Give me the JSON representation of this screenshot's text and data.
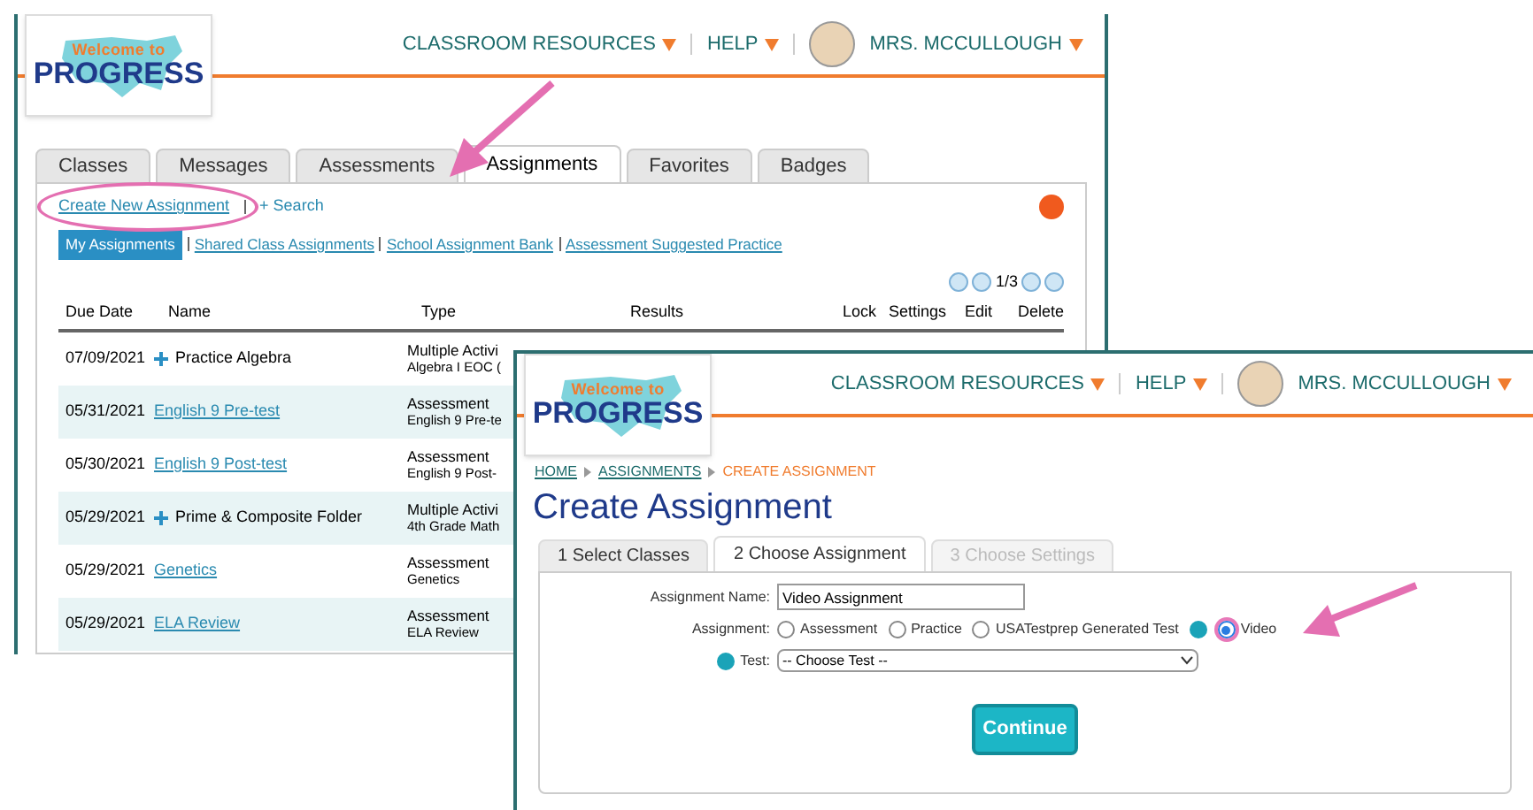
{
  "back_window": {
    "logo": {
      "line1": "Welcome to",
      "line2": "PROGRESS"
    },
    "nav": [
      {
        "label": "CLASSROOM RESOURCES"
      },
      {
        "label": "HELP"
      }
    ],
    "user": "MRS. MCCULLOUGH",
    "tabs": [
      {
        "label": "Classes",
        "selected": false
      },
      {
        "label": "Messages",
        "selected": false
      },
      {
        "label": "Assessments",
        "selected": false
      },
      {
        "label": "Assignments",
        "selected": true
      },
      {
        "label": "Favorites",
        "selected": false
      },
      {
        "label": "Badges",
        "selected": false
      }
    ],
    "actions": [
      {
        "label": "Create New Assignment"
      },
      {
        "label": "+ Search"
      }
    ],
    "subtabs": [
      {
        "label": "My Assignments",
        "selected": true
      },
      {
        "label": "Shared Class Assignments",
        "selected": false
      },
      {
        "label": "School Assignment Bank",
        "selected": false
      },
      {
        "label": "Assessment Suggested Practice",
        "selected": false
      }
    ],
    "pager": "1/3",
    "table": {
      "columns": [
        "Due Date",
        "Name",
        "Type",
        "Results",
        "Lock",
        "Settings",
        "Edit",
        "Delete"
      ],
      "rows": [
        {
          "due": "07/09/2021",
          "name": "Practice Algebra",
          "kind": "folder",
          "type": "Multiple Activi",
          "subtype": "Algebra I EOC ("
        },
        {
          "due": "05/31/2021",
          "name": "English 9 Pre-test",
          "kind": "link",
          "type": "Assessment",
          "subtype": "English 9 Pre-te"
        },
        {
          "due": "05/30/2021",
          "name": "English 9 Post-test",
          "kind": "link",
          "type": "Assessment",
          "subtype": "English 9 Post-"
        },
        {
          "due": "05/29/2021",
          "name": "Prime & Composite Folder",
          "kind": "folder",
          "type": "Multiple Activi",
          "subtype": "4th Grade Math"
        },
        {
          "due": "05/29/2021",
          "name": "Genetics",
          "kind": "link",
          "type": "Assessment",
          "subtype": "Genetics"
        },
        {
          "due": "05/29/2021",
          "name": "ELA Review",
          "kind": "link",
          "type": "Assessment",
          "subtype": "ELA Review"
        }
      ]
    }
  },
  "front_window": {
    "logo": {
      "line1": "Welcome to",
      "line2": "PROGRESS"
    },
    "nav": [
      {
        "label": "CLASSROOM RESOURCES"
      },
      {
        "label": "HELP"
      }
    ],
    "user": "MRS. MCCULLOUGH",
    "breadcrumb": [
      {
        "label": "HOME",
        "kind": "link"
      },
      {
        "label": "ASSIGNMENTS",
        "kind": "link"
      },
      {
        "label": "CREATE ASSIGNMENT",
        "kind": "current"
      }
    ],
    "title": "Create Assignment",
    "steps": [
      {
        "label": "1 Select Classes",
        "selected": false,
        "disabled": false
      },
      {
        "label": "2 Choose Assignment",
        "selected": true,
        "disabled": false
      },
      {
        "label": "3 Choose Settings",
        "selected": false,
        "disabled": true
      }
    ],
    "form": {
      "name_label": "Assignment Name:",
      "name_value": "Video Assignment",
      "assignment_label": "Assignment:",
      "options": [
        {
          "label": "Assessment",
          "selected": false,
          "info": false
        },
        {
          "label": "Practice",
          "selected": false,
          "info": false
        },
        {
          "label": "USATestprep Generated Test",
          "selected": false,
          "info": true
        },
        {
          "label": "Video",
          "selected": true,
          "info": false
        }
      ],
      "test_label": "Test:",
      "test_value": "-- Choose Test --",
      "continue": "Continue"
    }
  }
}
